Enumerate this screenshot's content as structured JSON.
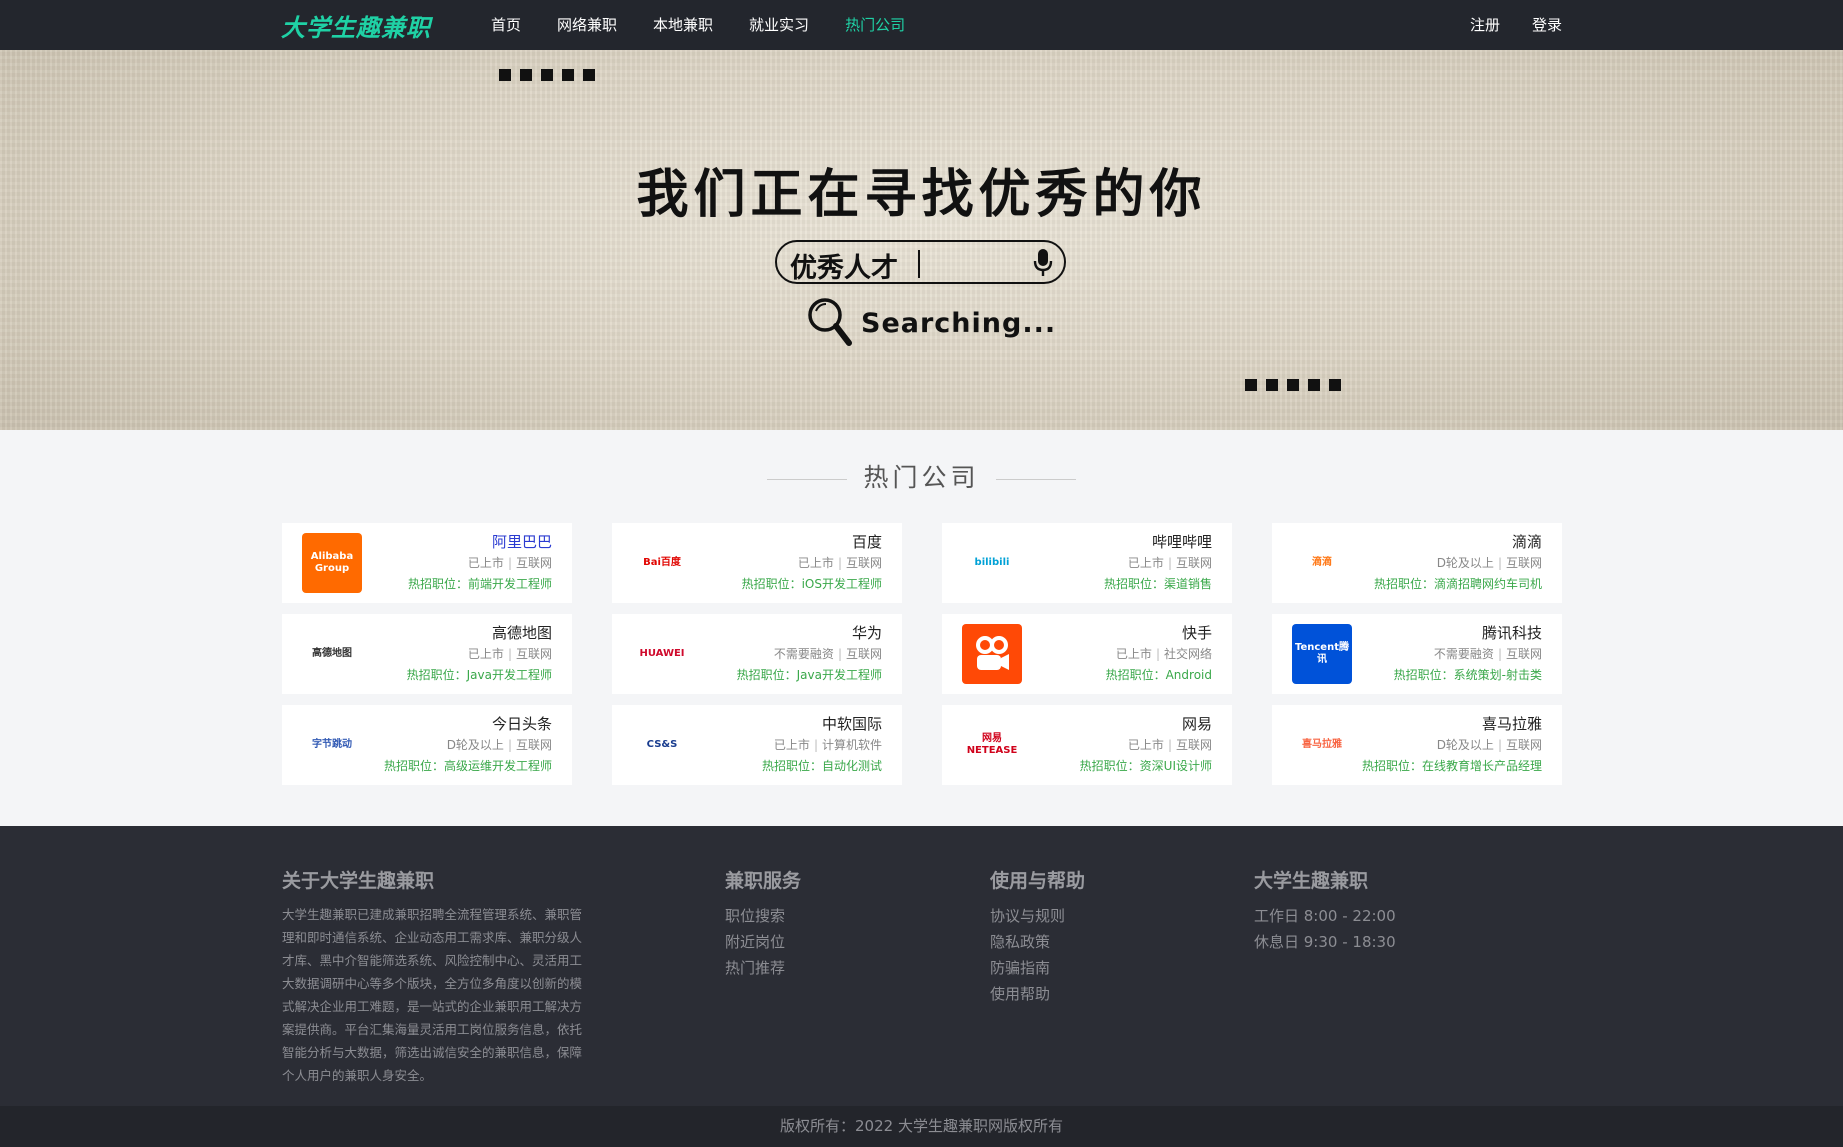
{
  "header": {
    "logo": "大学生趣兼职",
    "nav": [
      "首页",
      "网络兼职",
      "本地兼职",
      "就业实习",
      "热门公司"
    ],
    "active_nav": "热门公司",
    "register": "注册",
    "login": "登录",
    "accent_color": "#1fd1a5"
  },
  "banner": {
    "headline": "我们正在寻找优秀的你",
    "search_query": "优秀人才",
    "searching_text": "Searching..."
  },
  "companies_section": {
    "title": "热门公司",
    "cards": [
      {
        "name": "阿里巴巴",
        "status": "已上市",
        "industry": "互联网",
        "job": "热招职位：前端开发工程师",
        "logo_text": "Alibaba Group",
        "logo_bg": "#ff6a00",
        "logo_fg": "#ffffff"
      },
      {
        "name": "百度",
        "status": "已上市",
        "industry": "互联网",
        "job": "热招职位：iOS开发工程师",
        "logo_text": "Bai百度",
        "logo_bg": "#ffffff",
        "logo_fg": "#e10602"
      },
      {
        "name": "哔哩哔哩",
        "status": "已上市",
        "industry": "互联网",
        "job": "热招职位：渠道销售",
        "logo_text": "bilibili",
        "logo_bg": "#ffffff",
        "logo_fg": "#00a1d6"
      },
      {
        "name": "滴滴",
        "status": "D轮及以上",
        "industry": "互联网",
        "job": "热招职位：滴滴招聘网约车司机",
        "logo_text": "滴滴",
        "logo_bg": "#ffffff",
        "logo_fg": "#ff7a1a"
      },
      {
        "name": "高德地图",
        "status": "已上市",
        "industry": "互联网",
        "job": "热招职位：Java开发工程师",
        "logo_text": "高德地图",
        "logo_bg": "#ffffff",
        "logo_fg": "#333333"
      },
      {
        "name": "华为",
        "status": "不需要融资",
        "industry": "互联网",
        "job": "热招职位：Java开发工程师",
        "logo_text": "HUAWEI",
        "logo_bg": "#ffffff",
        "logo_fg": "#cf0a2c"
      },
      {
        "name": "快手",
        "status": "已上市",
        "industry": "社交网络",
        "job": "热招职位：Android",
        "logo_text": "",
        "logo_bg": "#ff4906",
        "logo_fg": "#ffffff"
      },
      {
        "name": "腾讯科技",
        "status": "不需要融资",
        "industry": "互联网",
        "job": "热招职位：系统策划-射击类",
        "logo_text": "Tencent腾讯",
        "logo_bg": "#0052d9",
        "logo_fg": "#ffffff"
      },
      {
        "name": "今日头条",
        "status": "D轮及以上",
        "industry": "互联网",
        "job": "热招职位：高级运维开发工程师",
        "logo_text": "字节跳动",
        "logo_bg": "#ffffff",
        "logo_fg": "#325ab4"
      },
      {
        "name": "中软国际",
        "status": "已上市",
        "industry": "计算机软件",
        "job": "热招职位：自动化测试",
        "logo_text": "CS&S",
        "logo_bg": "#ffffff",
        "logo_fg": "#1a3d8f"
      },
      {
        "name": "网易",
        "status": "已上市",
        "industry": "互联网",
        "job": "热招职位：资深UI设计师",
        "logo_text": "网易 NETEASE",
        "logo_bg": "#ffffff",
        "logo_fg": "#d0021b"
      },
      {
        "name": "喜马拉雅",
        "status": "D轮及以上",
        "industry": "互联网",
        "job": "热招职位：在线教育增长产品经理",
        "logo_text": "喜马拉雅",
        "logo_bg": "#ffffff",
        "logo_fg": "#f86442"
      }
    ]
  },
  "footer": {
    "about_title": "关于大学生趣兼职",
    "about_text": "大学生趣兼职已建成兼职招聘全流程管理系统、兼职管理和即时通信系统、企业动态用工需求库、兼职分级人才库、黑中介智能筛选系统、风险控制中心、灵活用工大数据调研中心等多个版块，全方位多角度以创新的模式解决企业用工难题，是一站式的企业兼职用工解决方案提供商。平台汇集海量灵活用工岗位服务信息，依托智能分析与大数据，筛选出诚信安全的兼职信息，保障个人用户的兼职人身安全。",
    "service_title": "兼职服务",
    "service_links": [
      "职位搜索",
      "附近岗位",
      "热门推荐"
    ],
    "help_title": "使用与帮助",
    "help_links": [
      "协议与规则",
      "隐私政策",
      "防骗指南",
      "使用帮助"
    ],
    "hours_title": "大学生趣兼职",
    "hours": [
      "工作日 8:00 - 22:00",
      "休息日 9:30 - 18:30"
    ],
    "copyright": "版权所有：2022 大学生趣兼职网版权所有"
  }
}
